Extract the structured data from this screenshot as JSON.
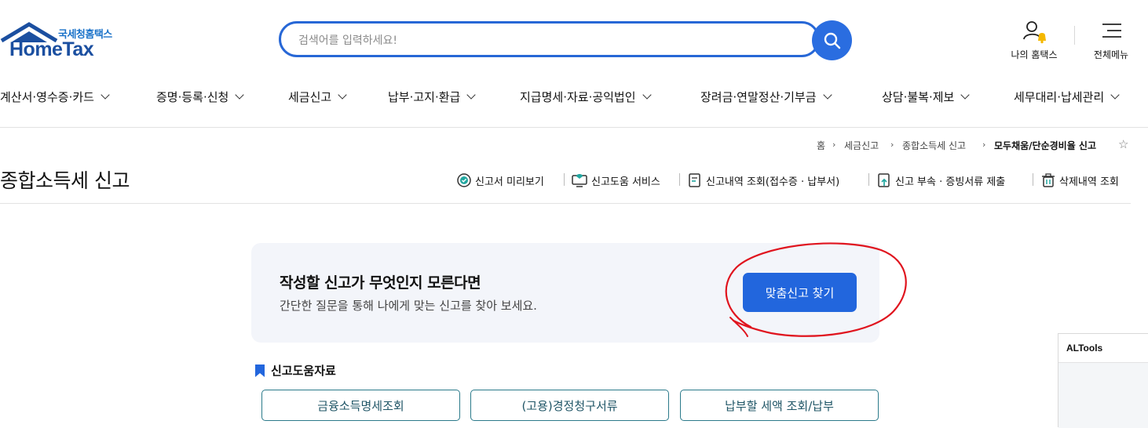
{
  "header": {
    "logo_ko": "국세청홈택스",
    "logo_en": "HomeTax",
    "search_placeholder": "검색어를 입력하세요!",
    "my_hometax": "나의 홈택스",
    "all_menu": "전체메뉴"
  },
  "gnb": [
    {
      "label": "계산서·영수증·카드"
    },
    {
      "label": "증명·등록·신청"
    },
    {
      "label": "세금신고"
    },
    {
      "label": "납부·고지·환급"
    },
    {
      "label": "지급명세·자료·공익법인"
    },
    {
      "label": "장려금·연말정산·기부금"
    },
    {
      "label": "상담·불복·제보"
    },
    {
      "label": "세무대리·납세관리"
    }
  ],
  "breadcrumb": [
    "홈",
    "세금신고",
    "종합소득세 신고",
    "모두채움/단순경비율 신고"
  ],
  "page": {
    "title": "종합소득세 신고",
    "utils": [
      "신고서 미리보기",
      "신고도움 서비스",
      "신고내역 조회(접수증 · 납부서)",
      "신고 부속 · 증빙서류 제출",
      "삭제내역 조회"
    ]
  },
  "finder": {
    "title": "작성할 신고가 무엇인지 모른다면",
    "desc": "간단한 질문을 통해 나에게 맞는 신고를 찾아 보세요.",
    "button": "맞춤신고 찾기"
  },
  "help": {
    "title": "신고도움자료",
    "buttons": [
      "금융소득명세조회",
      "(고용)경정청구서류",
      "납부할 세액 조회/납부"
    ]
  },
  "altools": {
    "title": "ALTools"
  },
  "colors": {
    "primary": "#2266dd",
    "annotation": "#e0141e",
    "help_border": "#2b7a8a"
  }
}
